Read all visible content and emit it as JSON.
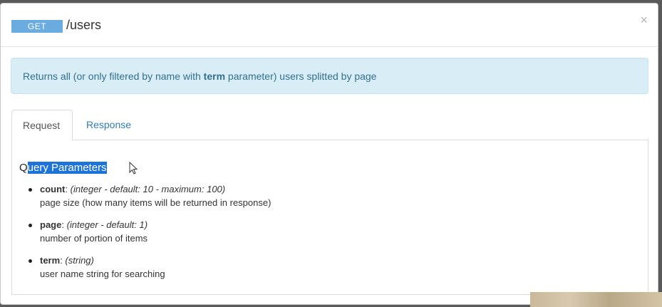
{
  "header": {
    "method": "GET",
    "path": "/users",
    "close_label": "×"
  },
  "info": {
    "before": "Returns all (or only filtered by name with ",
    "keyword": "term",
    "after": " parameter) users splitted by page"
  },
  "tabs": [
    {
      "label": "Request",
      "active": true
    },
    {
      "label": "Response",
      "active": false
    }
  ],
  "section": {
    "title_first": "Q",
    "title_selected": "uery Parameters"
  },
  "params": [
    {
      "name": "count",
      "sep": ": ",
      "type": "(integer - default: 10 - maximum: 100)",
      "desc": "page size (how many items will be returned in response)"
    },
    {
      "name": "page",
      "sep": ": ",
      "type": "(integer - default: 1)",
      "desc": "number of portion of items"
    },
    {
      "name": "term",
      "sep": ": ",
      "type": "(string)",
      "desc": "user name string for searching"
    }
  ],
  "colors": {
    "method_badge": "#6bace0",
    "info_bg": "#d9edf7",
    "info_text": "#31708f",
    "link": "#337ab7",
    "selection": "#1e73d9"
  },
  "icons": [
    "close-icon",
    "mouse-cursor-icon"
  ]
}
